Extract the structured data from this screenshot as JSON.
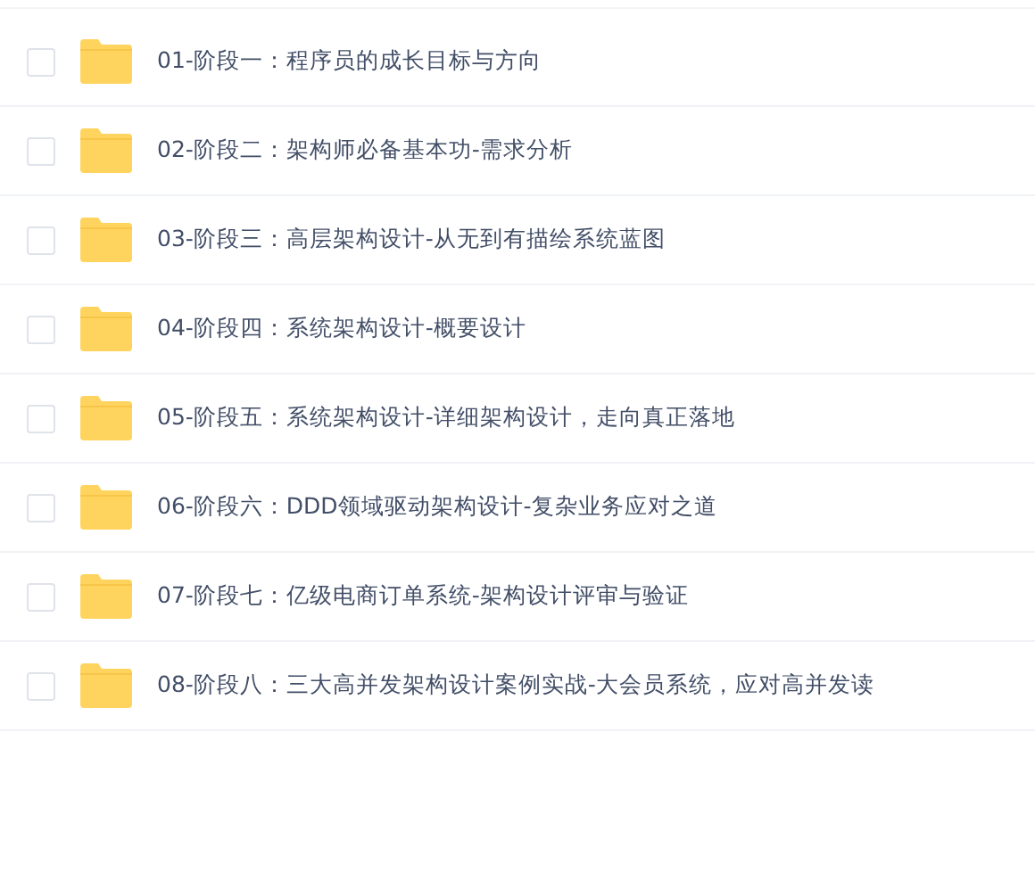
{
  "files": [
    {
      "name": "01-阶段一：程序员的成长目标与方向",
      "checked": false
    },
    {
      "name": "02-阶段二：架构师必备基本功-需求分析",
      "checked": false
    },
    {
      "name": "03-阶段三：高层架构设计-从无到有描绘系统蓝图",
      "checked": false
    },
    {
      "name": "04-阶段四：系统架构设计-概要设计",
      "checked": false
    },
    {
      "name": "05-阶段五：系统架构设计-详细架构设计，走向真正落地",
      "checked": false
    },
    {
      "name": "06-阶段六：DDD领域驱动架构设计-复杂业务应对之道",
      "checked": false
    },
    {
      "name": "07-阶段七：亿级电商订单系统-架构设计评审与验证",
      "checked": false
    },
    {
      "name": "08-阶段八：三大高并发架构设计案例实战-大会员系统，应对高并发读",
      "checked": false
    }
  ]
}
